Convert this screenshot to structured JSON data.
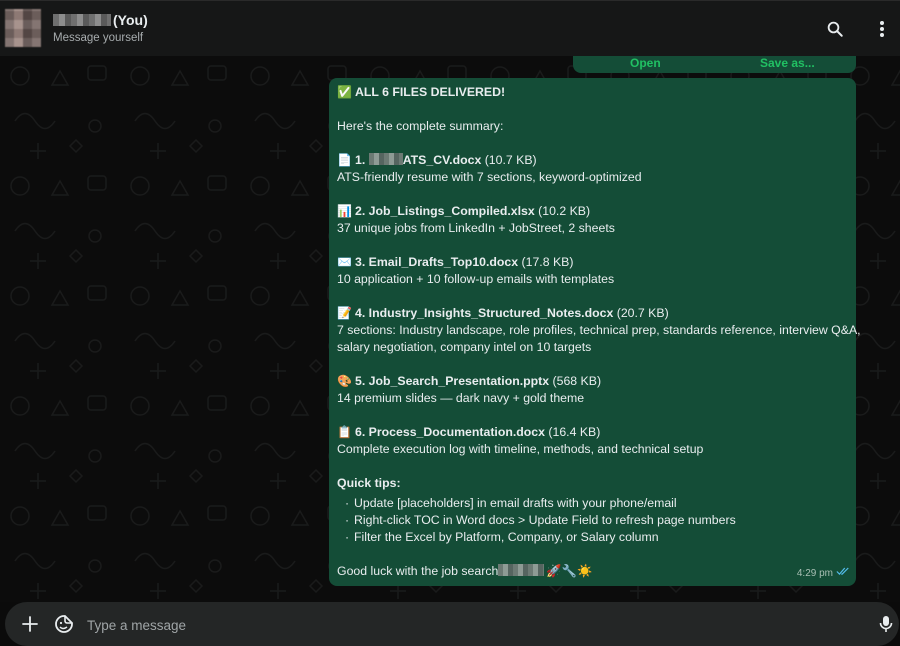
{
  "header": {
    "title": "(You)",
    "subtitle": "Message yourself",
    "icons": {
      "search": "search-icon",
      "menu": "kebab-menu-icon"
    }
  },
  "previous_message": {
    "open_label": "Open",
    "save_as_label": "Save as..."
  },
  "message": {
    "heading_emoji": "✅",
    "heading": "ALL 6 FILES DELIVERED!",
    "intro": "Here's the complete summary:",
    "files": [
      {
        "emoji": "📄",
        "prefix": "1. ",
        "name": "ATS_CV.docx",
        "size": "(10.7 KB)",
        "desc": "ATS-friendly resume with 7 sections, keyword-optimized"
      },
      {
        "emoji": "📊",
        "prefix": "",
        "name": "2. Job_Listings_Compiled.xlsx",
        "size": "(10.2 KB)",
        "desc": "37 unique jobs from LinkedIn + JobStreet, 2 sheets"
      },
      {
        "emoji": "✉️",
        "prefix": "",
        "name": "3. Email_Drafts_Top10.docx",
        "size": "(17.8 KB)",
        "desc": "10 application + 10 follow-up emails with templates"
      },
      {
        "emoji": "📝",
        "prefix": "",
        "name": "4. Industry_Insights_Structured_Notes.docx",
        "size": "(20.7 KB)",
        "desc": "7 sections: Industry landscape, role profiles, technical prep, standards reference, interview Q&A,",
        "desc2": "salary negotiation, company intel on 10 targets"
      },
      {
        "emoji": "🎨",
        "prefix": "",
        "name": "5. Job_Search_Presentation.pptx",
        "size": "(568 KB)",
        "desc": "14 premium slides — dark navy + gold theme"
      },
      {
        "emoji": "📋",
        "prefix": "",
        "name": "6. Process_Documentation.docx",
        "size": "(16.4 KB)",
        "desc": "Complete execution log with timeline, methods, and technical setup"
      }
    ],
    "tips_heading": "Quick tips:",
    "tips": [
      "Update [placeholders] in email drafts with your phone/email",
      "Right-click TOC in Word docs > Update Field to refresh page numbers",
      "Filter the Excel by Platform, Company, or Salary column"
    ],
    "closing": "Good luck with the job search",
    "closing_emojis": "🚀🔧☀️",
    "time": "4:29 pm",
    "status_icon": "double-check-read-icon"
  },
  "composer": {
    "placeholder": "Type a message",
    "value": "",
    "icons": {
      "attach": "plus-icon",
      "sticker": "sticker-icon",
      "mic": "microphone-icon"
    }
  },
  "colors": {
    "header_bg": "#161717",
    "chat_bg": "#0c0c0c",
    "bubble_bg": "#144d37",
    "accent_green": "#21c063",
    "composer_bg": "#242626",
    "read_tick": "#53bdeb"
  }
}
